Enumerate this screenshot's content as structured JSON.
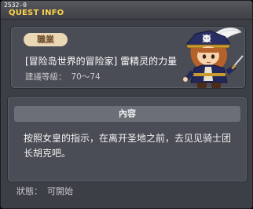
{
  "window": {
    "quest_id": "2532-0",
    "title": "QUEST INFO"
  },
  "quest": {
    "job_badge": "職業",
    "name": "[冒险岛世界的冒险家] 雷精灵的力量",
    "recommended_level_label": "建議等級：",
    "recommended_level": "70～74"
  },
  "content": {
    "header": "內容",
    "text": "按照女皇的指示，在离开圣地之前，去见见骑士团长胡克吧。"
  },
  "status": {
    "label": "狀態：",
    "value": "可開始"
  },
  "colors": {
    "title": "#ffd34a",
    "badge_bg": "#ead7b6",
    "panel": "#4a4d55"
  },
  "icons": {
    "portrait": "captain-character-portrait"
  }
}
